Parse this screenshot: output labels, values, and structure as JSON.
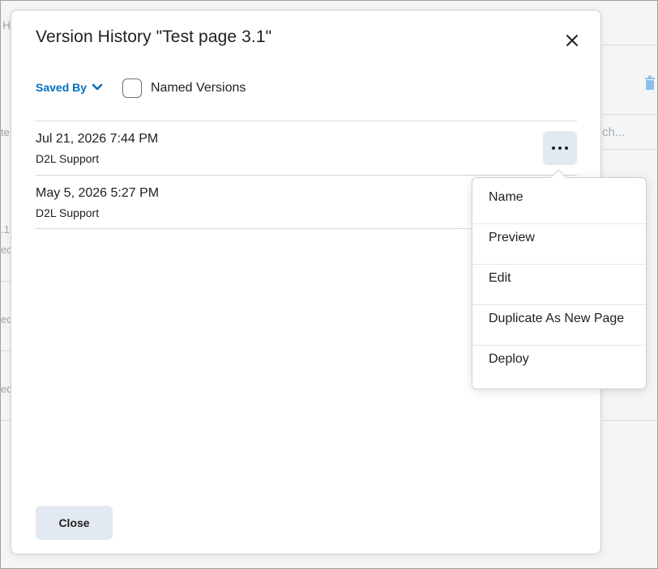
{
  "dialog": {
    "title": "Version History \"Test page 3.1\"",
    "filters": {
      "saved_by_label": "Saved By",
      "named_versions_label": "Named Versions",
      "named_versions_checked": false
    },
    "versions": [
      {
        "date": "Jul 21, 2026 7:44 PM",
        "user": "D2L Support"
      },
      {
        "date": "May 5, 2026 5:27 PM",
        "user": "D2L Support"
      }
    ],
    "close_button_label": "Close"
  },
  "context_menu": {
    "items": [
      {
        "label": "Name"
      },
      {
        "label": "Preview"
      },
      {
        "label": "Edit"
      },
      {
        "label": "Duplicate As New Page"
      },
      {
        "label": "Deploy"
      }
    ]
  },
  "background": {
    "frag_top_left": "H",
    "search_placeholder_fragment": "ch...",
    "frag_row1": ".1",
    "frag_row1b": "ed",
    "frag_row2": "ed",
    "frag_row3": "ed",
    "frag_col": "te"
  },
  "colors": {
    "accent": "#006fbf",
    "button_bg": "#e3e9f1",
    "trash_icon": "#8fbfe8"
  }
}
